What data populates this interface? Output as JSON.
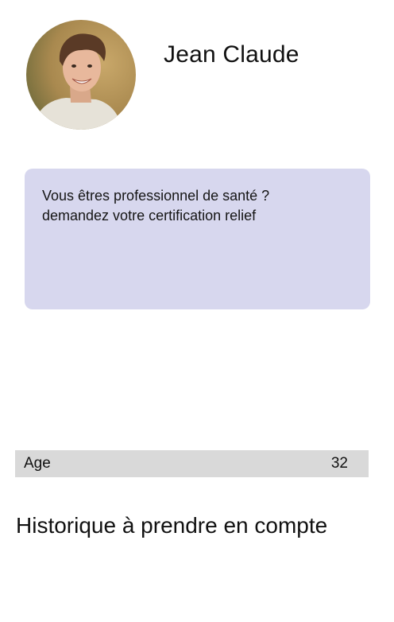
{
  "profile": {
    "name": "Jean Claude",
    "avatar_icon": "profile-photo"
  },
  "promo": {
    "line1": "Vous êtres professionnel de santé ?",
    "line2": "demandez votre certification relief",
    "background": "#d7d7ee"
  },
  "age": {
    "label": "Age",
    "value": "32"
  },
  "history": {
    "title": "Historique à prendre en compte"
  }
}
